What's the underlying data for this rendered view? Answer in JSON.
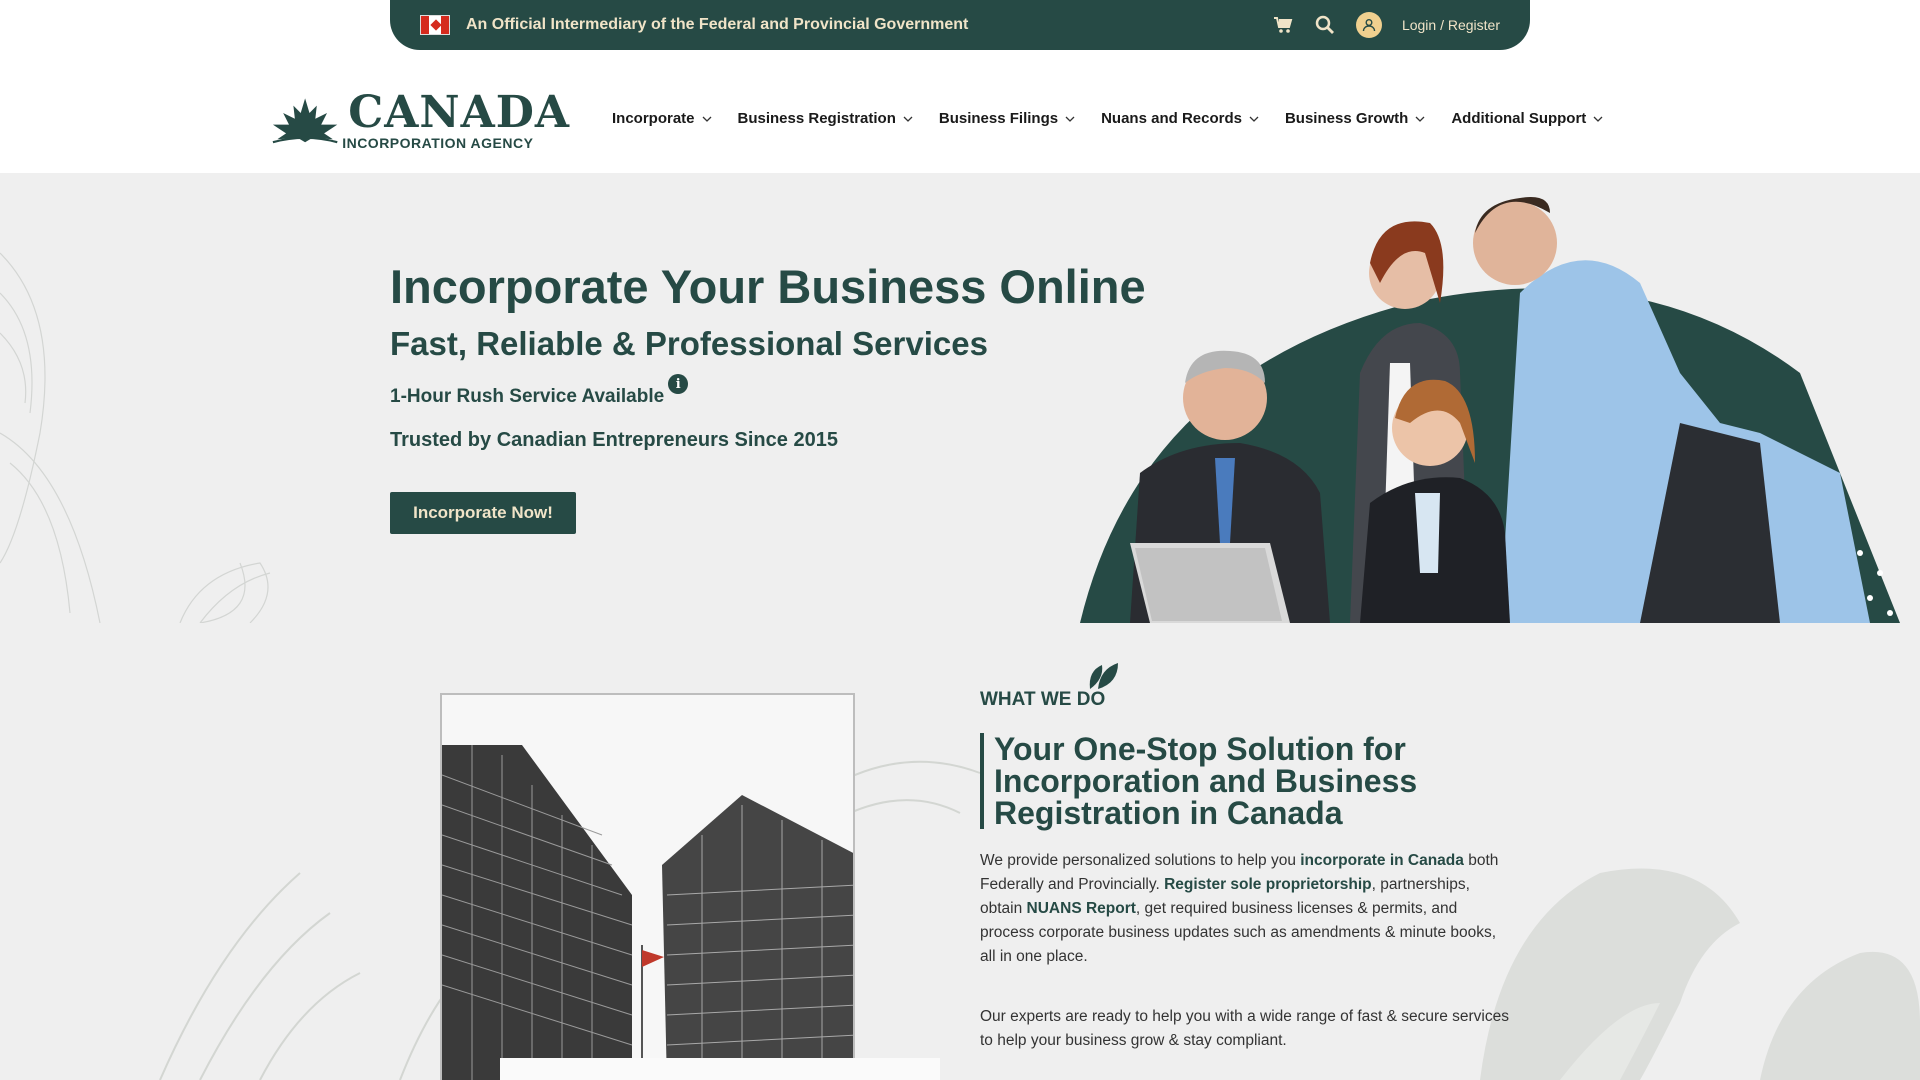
{
  "topbar": {
    "official_text": "An Official Intermediary of the Federal and Provincial Government",
    "login_label": "Login / Register",
    "cart_icon": "cart-icon",
    "search_icon": "search-icon",
    "user_icon": "user-icon"
  },
  "logo": {
    "main": "CANADA",
    "sub": "INCORPORATION AGENCY"
  },
  "nav": {
    "items": [
      {
        "label": "Incorporate"
      },
      {
        "label": "Business Registration"
      },
      {
        "label": "Business Filings"
      },
      {
        "label": "Nuans and Records"
      },
      {
        "label": "Business Growth"
      },
      {
        "label": "Additional Support"
      }
    ]
  },
  "hero": {
    "title": "Incorporate Your Business Online",
    "subtitle": "Fast, Reliable & Professional Services",
    "rush": "1-Hour Rush Service Available",
    "trusted": "Trusted by Canadian Entrepreneurs Since 2015",
    "cta": "Incorporate Now!"
  },
  "section2": {
    "eyebrow": "WHAT WE DO",
    "heading_lines": [
      "Your One-Stop Solution for",
      "Incorporation and Business",
      "Registration in Canada"
    ],
    "p1": {
      "t1": "We provide personalized solutions to help you ",
      "b1": "incorporate in Canada",
      "t2": " both Federally and Provincially. ",
      "b2": "Register sole proprietorship",
      "t3": ", partnerships, obtain ",
      "b3": "NUANS Report",
      "t4": ", get required business licenses & permits, and process corporate business updates such as amendments & minute books, all in one place."
    },
    "p2": "Our experts are ready to help you with a wide range of fast & secure services to help your business grow & stay compliant."
  },
  "colors": {
    "brand": "#264a45",
    "accent": "#f0e4c8",
    "background": "#efefef"
  }
}
